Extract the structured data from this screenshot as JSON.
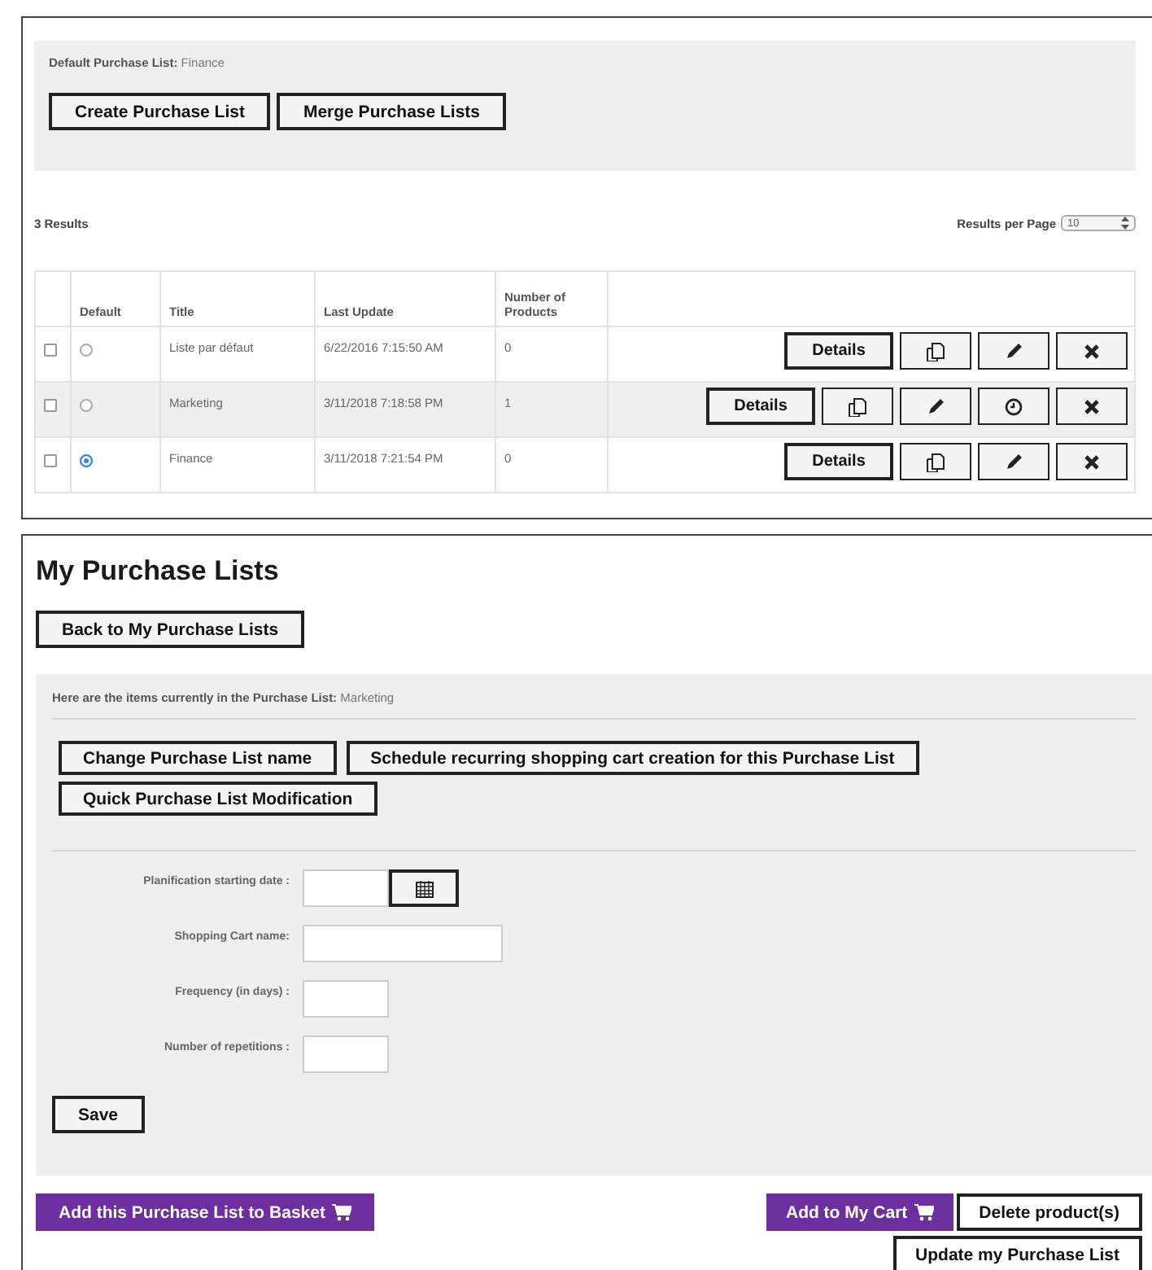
{
  "default_list": {
    "label": "Default Purchase List:",
    "value": "Finance"
  },
  "top_buttons": [
    "Create Purchase List",
    "Merge Purchase Lists"
  ],
  "results_count": "3 Results",
  "results_per_page": {
    "label": "Results per Page",
    "value": "10"
  },
  "table": {
    "columns": [
      "Default",
      "Title",
      "Last Update",
      "Number of Products"
    ],
    "rows": [
      {
        "checked": false,
        "selected": false,
        "highlighted": false,
        "title": "Liste par défaut",
        "last_update": "6/22/2016 7:15:50 AM",
        "products": "0",
        "actions": [
          {
            "kind": "details",
            "label": "Details"
          },
          {
            "kind": "copy"
          },
          {
            "kind": "edit"
          },
          {
            "kind": "delete"
          }
        ]
      },
      {
        "checked": false,
        "selected": false,
        "highlighted": true,
        "title": "Marketing",
        "last_update": "3/11/2018 7:18:58 PM",
        "products": "1",
        "actions": [
          {
            "kind": "details",
            "label": "Details"
          },
          {
            "kind": "copy"
          },
          {
            "kind": "edit"
          },
          {
            "kind": "schedule"
          },
          {
            "kind": "delete"
          }
        ]
      },
      {
        "checked": false,
        "selected": true,
        "highlighted": false,
        "title": "Finance",
        "last_update": "3/11/2018 7:21:54 PM",
        "products": "0",
        "actions": [
          {
            "kind": "details",
            "label": "Details"
          },
          {
            "kind": "copy"
          },
          {
            "kind": "edit"
          },
          {
            "kind": "delete"
          }
        ]
      }
    ]
  },
  "page_title": "My Purchase Lists",
  "back_button": "Back to My Purchase Lists",
  "current_list": {
    "label": "Here are the items currently in the Purchase List:",
    "value": "Marketing"
  },
  "list_actions": [
    "Change Purchase List name",
    "Schedule recurring shopping cart creation for this Purchase List",
    "Quick Purchase List Modification"
  ],
  "schedule_form": {
    "fields": [
      {
        "label": "Planification starting date :",
        "kind": "date"
      },
      {
        "label": "Shopping Cart name:",
        "kind": "wide"
      },
      {
        "label": "Frequency (in days) :",
        "kind": "short"
      },
      {
        "label": "Number of repetitions :",
        "kind": "short"
      }
    ],
    "save": "Save"
  },
  "footer_left": [
    {
      "label": "Add this Purchase List to Basket",
      "kind": "primary"
    }
  ],
  "footer_right": [
    {
      "label": "Add to My Cart",
      "kind": "primary"
    },
    {
      "label": "Delete product(s)",
      "kind": "outline"
    },
    {
      "label": "Update my Purchase List",
      "kind": "outline"
    }
  ]
}
